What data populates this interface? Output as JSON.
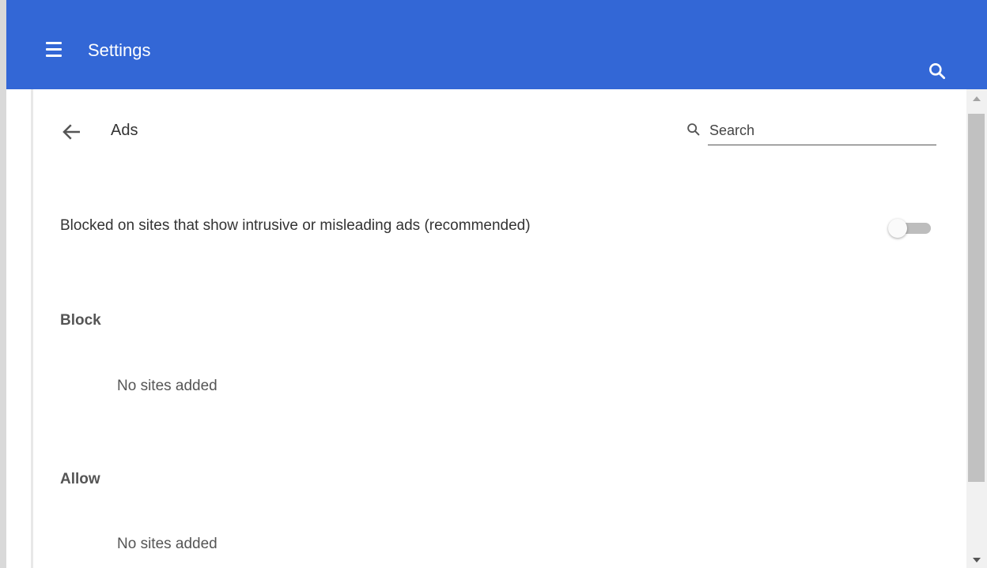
{
  "header": {
    "title": "Settings",
    "menu_icon": "hamburger-menu-icon",
    "search_icon": "search-icon",
    "color": "#3367d6"
  },
  "page": {
    "title": "Ads",
    "back_icon": "arrow-back-icon",
    "search": {
      "placeholder": "Search",
      "value": "",
      "icon": "search-icon"
    }
  },
  "setting": {
    "label": "Blocked on sites that show intrusive or misleading ads (recommended)",
    "toggle_on": false
  },
  "sections": {
    "block": {
      "title": "Block",
      "empty": "No sites added"
    },
    "allow": {
      "title": "Allow",
      "empty": "No sites added"
    }
  }
}
